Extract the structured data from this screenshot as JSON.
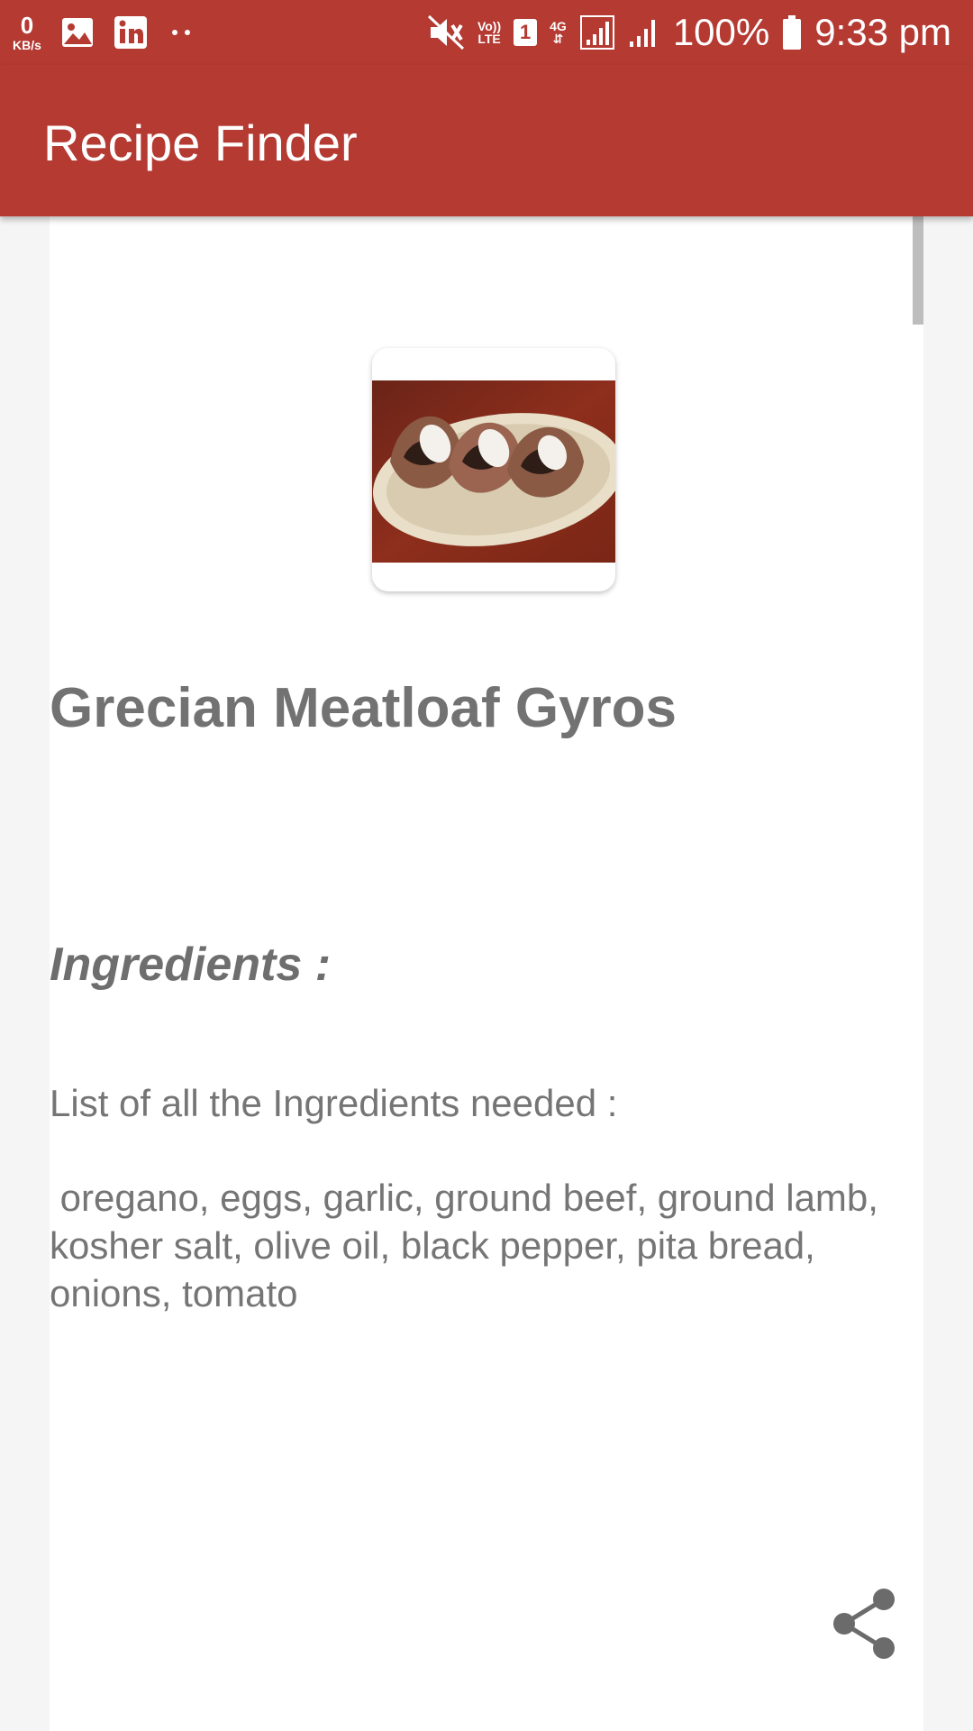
{
  "status_bar": {
    "net_speed_value": "0",
    "net_speed_unit": "KB/s",
    "volte_top": "Vo))",
    "volte_bottom": "LTE",
    "sim_slot": "1",
    "network_type": "4G",
    "battery": "100%",
    "time": "9:33 pm"
  },
  "app_bar": {
    "title": "Recipe Finder"
  },
  "recipe": {
    "title": "Grecian Meatloaf Gyros",
    "ingredients_heading": "Ingredients :",
    "ingredients_intro": "List of all the Ingredients needed :",
    "ingredients_list": " oregano, eggs, garlic, ground beef, ground lamb, kosher salt, olive oil, black pepper, pita bread, onions, tomato",
    "image_icon": "food-photo"
  },
  "actions": {
    "share_icon": "share-icon"
  },
  "colors": {
    "primary": "#b43a32",
    "text_gray": "#757575",
    "background": "#f5f5f5"
  }
}
